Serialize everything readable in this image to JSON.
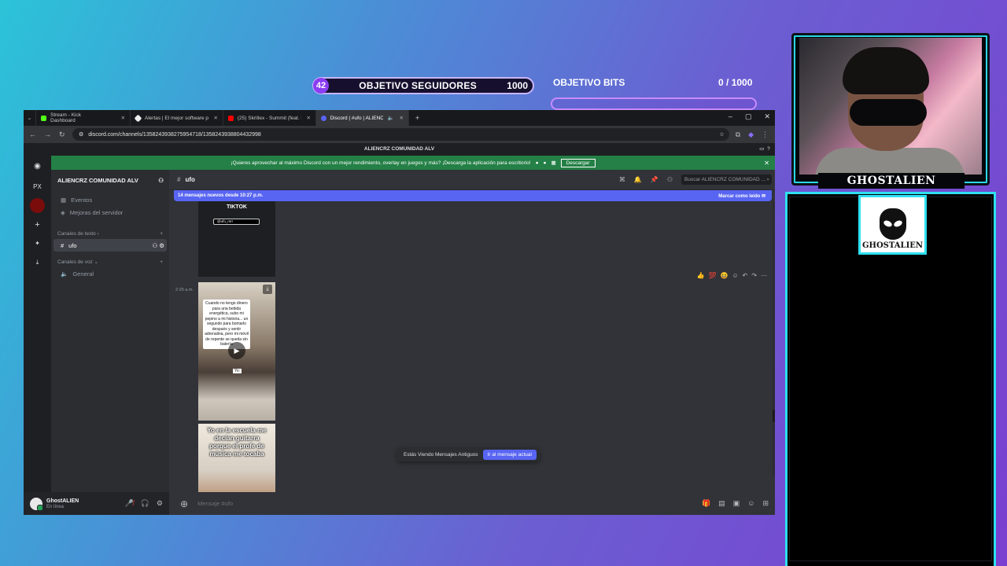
{
  "overlay": {
    "followers_goal": {
      "current": "42",
      "label": "OBJETIVO SEGUIDORES",
      "target": "1000"
    },
    "bits_goal": {
      "label": "OBJETIVO BITS",
      "current": "0",
      "target": "1000",
      "progress": 0
    },
    "cam_name": "GHOSTALIEN",
    "logo_text": "GHOSTALIEN",
    "accent_color": "#2ee0f0"
  },
  "browser": {
    "tabs": [
      {
        "label": "Stream - Kick Dashboard",
        "color": "#53fc18"
      },
      {
        "label": "Alertas | El mejor software para",
        "color": "#eeeeee"
      },
      {
        "label": "(25) Skrillex - Summit (feat. Elli",
        "color": "#ff0000"
      },
      {
        "label": "Discord | #ufo | ALIENCR",
        "color": "#5865f2"
      }
    ],
    "url": "discord.com/channels/1358243938275954718/1358243938804432998"
  },
  "discord": {
    "window_title": "ALIENCRZ COMUNIDAD ALV",
    "notice": {
      "text": "¡Quieres aprovechar al máximo Discord con un mejor rendimiento, overlay en juegos y más? ¡Descarga la aplicación para escritorio!",
      "button": "Descargar"
    },
    "server_label": "PX",
    "guild_name": "ALIENCRZ COMUNIDAD ALV",
    "nav": [
      {
        "label": "Eventos"
      },
      {
        "label": "Mejoras del servidor"
      }
    ],
    "text_category": "Canales de texto",
    "text_channel": "ufo",
    "voice_category": "Canales de voz",
    "voice_channel": "General",
    "user": {
      "name": "GhostALIEN",
      "status": "En línea"
    },
    "channel_name": "ufo",
    "search_placeholder": "Buscar ALIENCRZ COMUNIDAD ...",
    "new_messages": "14 mensajes nuevos desde 10:27 p.m.",
    "mark_read": "Marcar como leído",
    "embed_title": "TIKTOK",
    "embed_handle": "@ufo_mrr",
    "timestamp": "2:29 a.m.",
    "video1_caption": "Cuando no tengo dinero para una bebida energética, subo mi pepino a mi historia... un segundo para bomarlo después y sentir adrenalina, pero mi móvil de repente se queda sin batería",
    "video1_label": "Yo:",
    "video2_caption": "Yo en la escuela me decían guitarra porque el profe de música me tocaba",
    "jump_text": "Estás Viendo Mensajes Antiguos",
    "jump_button": "Ir al mensaje actual",
    "composer_placeholder": "Mensaje #ufo"
  }
}
